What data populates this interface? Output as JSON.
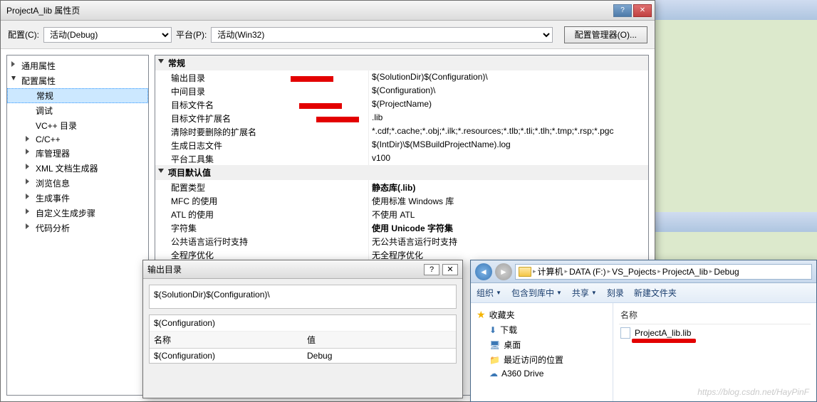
{
  "dialog": {
    "title": "ProjectA_lib 属性页",
    "help_icon": "?",
    "close_icon": "✕"
  },
  "config": {
    "label_config": "配置(C):",
    "value_config": "活动(Debug)",
    "label_platform": "平台(P):",
    "value_platform": "活动(Win32)",
    "btn_manager": "配置管理器(O)..."
  },
  "tree": [
    {
      "label": "通用属性",
      "lvl": 1,
      "arrow": "closed"
    },
    {
      "label": "配置属性",
      "lvl": 1,
      "arrow": "open"
    },
    {
      "label": "常规",
      "lvl": 2,
      "selected": true
    },
    {
      "label": "调试",
      "lvl": 2
    },
    {
      "label": "VC++ 目录",
      "lvl": 2
    },
    {
      "label": "C/C++",
      "lvl": 2,
      "arrow": "closed"
    },
    {
      "label": "库管理器",
      "lvl": 2,
      "arrow": "closed"
    },
    {
      "label": "XML 文档生成器",
      "lvl": 2,
      "arrow": "closed"
    },
    {
      "label": "浏览信息",
      "lvl": 2,
      "arrow": "closed"
    },
    {
      "label": "生成事件",
      "lvl": 2,
      "arrow": "closed"
    },
    {
      "label": "自定义生成步骤",
      "lvl": 2,
      "arrow": "closed"
    },
    {
      "label": "代码分析",
      "lvl": 2,
      "arrow": "closed"
    }
  ],
  "sections": [
    {
      "title": "常规",
      "rows": [
        {
          "k": "输出目录",
          "v": "$(SolutionDir)$(Configuration)\\",
          "mark": true
        },
        {
          "k": "中间目录",
          "v": "$(Configuration)\\"
        },
        {
          "k": "目标文件名",
          "v": "$(ProjectName)",
          "mark": true
        },
        {
          "k": "目标文件扩展名",
          "v": ".lib",
          "mark": true
        },
        {
          "k": "清除时要删除的扩展名",
          "v": "*.cdf;*.cache;*.obj;*.ilk;*.resources;*.tlb;*.tli;*.tlh;*.tmp;*.rsp;*.pgc"
        },
        {
          "k": "生成日志文件",
          "v": "$(IntDir)\\$(MSBuildProjectName).log"
        },
        {
          "k": "平台工具集",
          "v": "v100"
        }
      ]
    },
    {
      "title": "项目默认值",
      "rows": [
        {
          "k": "配置类型",
          "v": "静态库(.lib)",
          "bold": true
        },
        {
          "k": "MFC 的使用",
          "v": "使用标准 Windows 库"
        },
        {
          "k": "ATL 的使用",
          "v": "不使用 ATL"
        },
        {
          "k": "字符集",
          "v": "使用 Unicode 字符集",
          "bold": true
        },
        {
          "k": "公共语言运行时支持",
          "v": "无公共语言运行时支持"
        },
        {
          "k": "全程序优化",
          "v": "无全程序优化"
        }
      ]
    }
  ],
  "macro": {
    "title": "输出目录",
    "help_icon": "?",
    "close_icon": "✕",
    "expanded_value": "$(SolutionDir)$(Configuration)\\",
    "macro_header": "$(Configuration)",
    "col_name": "名称",
    "col_value": "值",
    "row_name": "$(Configuration)",
    "row_value": "Debug"
  },
  "explorer": {
    "breadcrumb": [
      "计算机",
      "DATA (F:)",
      "VS_Pojects",
      "ProjectA_lib",
      "Debug"
    ],
    "toolbar": {
      "organize": "组织",
      "include": "包含到库中",
      "share": "共享",
      "burn": "刻录",
      "newfolder": "新建文件夹"
    },
    "tree": {
      "favorites": "收藏夹",
      "downloads": "下载",
      "desktop": "桌面",
      "recent": "最近访问的位置",
      "a360": "A360 Drive"
    },
    "files": {
      "col_name": "名称",
      "file1": "ProjectA_lib.lib"
    },
    "watermark": "https://blog.csdn.net/HayPinF"
  }
}
